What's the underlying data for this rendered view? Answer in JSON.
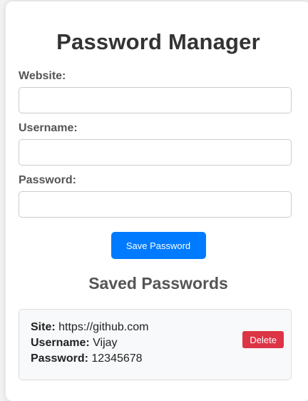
{
  "form": {
    "title": "Password Manager",
    "website_label": "Website:",
    "website_value": "",
    "username_label": "Username:",
    "username_value": "",
    "password_label": "Password:",
    "password_value": "",
    "save_label": "Save Password"
  },
  "saved": {
    "title": "Saved Passwords",
    "entries": [
      {
        "site_label": "Site:",
        "site": "https://github.com",
        "username_label": "Username:",
        "username": "Vijay",
        "password_label": "Password:",
        "password": "12345678",
        "delete_label": "Delete"
      }
    ]
  },
  "colors": {
    "primary": "#007bff",
    "danger": "#dc3545",
    "card_background": "#ffffff",
    "page_background": "#f2f2f2",
    "entry_background": "#f8f9fa"
  }
}
